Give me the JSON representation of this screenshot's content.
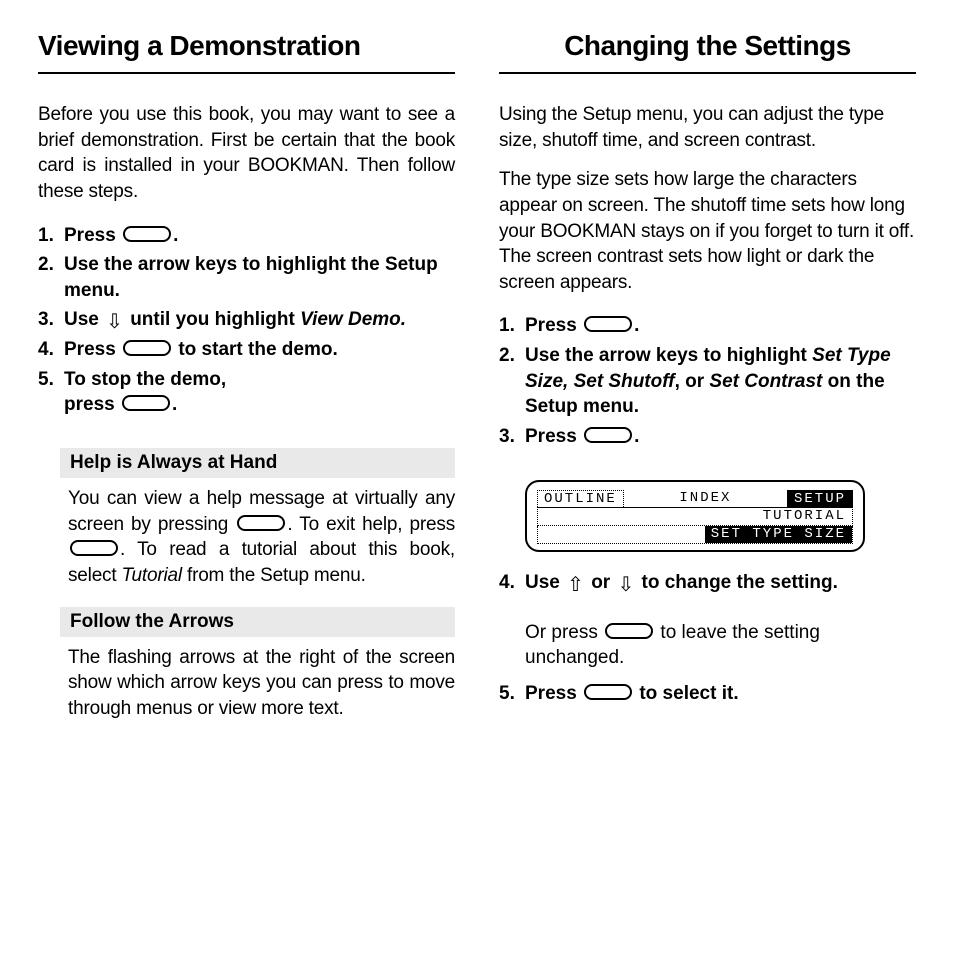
{
  "left": {
    "title": "Viewing a Demonstration",
    "intro": "Before you use this book, you may want to see a brief demonstration. First be certain that the book card is installed in your BOOKMAN. Then follow these steps.",
    "steps": {
      "s1a": "Press",
      "s1b": ".",
      "s2": "Use the arrow keys to highlight the Setup menu.",
      "s3a": "Use",
      "s3b": "until you highlight",
      "s3c": "View Demo.",
      "s4a": "Press",
      "s4b": "to start the demo.",
      "s5a": "To stop the demo,",
      "s5b": "press",
      "s5c": "."
    },
    "note1_head": "Help is Always at Hand",
    "note1_a": "You can view a help message at virtually any screen by pressing",
    "note1_b": ". To exit help, press",
    "note1_c": ". To read a tutorial about this book, select",
    "note1_d": "Tutorial",
    "note1_e": "from the Setup menu.",
    "note2_head": "Follow the Arrows",
    "note2_body": "The flashing arrows at the right of the screen show which arrow keys you can press to move through menus or view more text."
  },
  "right": {
    "title": "Changing the Settings",
    "intro1": "Using the Setup menu, you can adjust the type size, shutoff time, and screen contrast.",
    "intro2": "The type size sets how large the characters appear on screen. The shutoff time sets how long your BOOKMAN stays on if you forget to turn it off. The screen contrast sets how light or dark the screen appears.",
    "steps": {
      "s1a": "Press",
      "s1b": ".",
      "s2a": "Use the arrow keys to highlight",
      "s2b": "Set Type Size, Set Shutoff",
      "s2c": ", or",
      "s2d": "Set Contrast",
      "s2e": "on the Setup menu.",
      "s3a": "Press",
      "s3b": ".",
      "s4a": "Use",
      "s4b": "or",
      "s4c": "to change the setting.",
      "s4sub_a": "Or press",
      "s4sub_b": "to leave the setting unchanged.",
      "s5a": "Press",
      "s5b": "to select it."
    },
    "lcd": {
      "tab1": "OUTLINE",
      "tab2": "INDEX",
      "tab3": "SETUP",
      "row2": "TUTORIAL",
      "row3": "SET TYPE SIZE"
    }
  }
}
